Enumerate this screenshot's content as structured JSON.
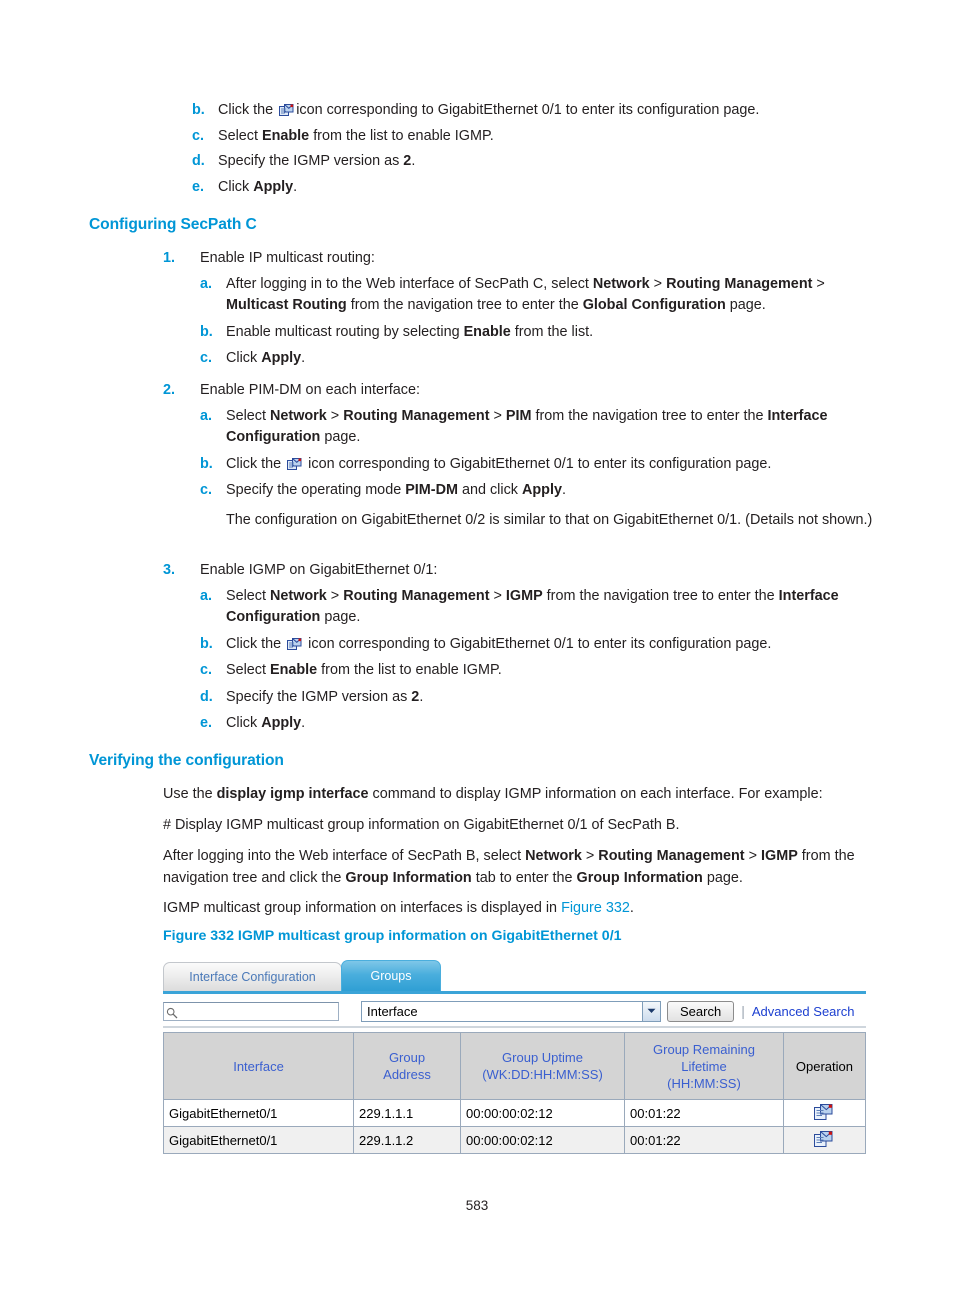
{
  "colors": {
    "heading_blue": "#0096d6",
    "marker_blue": "#0096d6",
    "link_blue": "#1c3fd0",
    "table_header_link": "#3a5fd0",
    "tab_active": "#2f9fd4"
  },
  "top_list": {
    "items": [
      {
        "marker": "b.",
        "pre": "Click the",
        "icon": "edit-document-icon",
        "post": "icon corresponding to GigabitEthernet 0/1 to enter its configuration page."
      },
      {
        "marker": "c.",
        "pre": "Select",
        "bold": "Enable",
        "post": "from the list to enable IGMP."
      },
      {
        "marker": "d.",
        "pre": "Specify the IGMP version as",
        "bold": "2",
        "post": "."
      },
      {
        "marker": "e.",
        "pre": "Click",
        "bold": "Apply",
        "post": "."
      }
    ]
  },
  "section_secpath_c": {
    "heading": "Configuring SecPath C",
    "step1": {
      "marker": "1.",
      "text": "Enable IP multicast routing:",
      "subs": [
        {
          "marker": "a.",
          "seg1": "After logging in to the Web interface of SecPath C, select ",
          "b1": "Network",
          "sep1": " > ",
          "b2": "Routing Management",
          "sep2": " > ",
          "b3": "Multicast Routing",
          "seg2": " from the navigation tree to enter the ",
          "b4": "Global Configuration",
          "seg3": " page."
        },
        {
          "marker": "b.",
          "seg1": "Enable multicast routing by selecting ",
          "b1": "Enable",
          "seg2": " from the list."
        },
        {
          "marker": "c.",
          "seg1": "Click ",
          "b1": "Apply",
          "seg2": "."
        }
      ]
    },
    "step2": {
      "marker": "2.",
      "text": "Enable PIM-DM on each interface:",
      "subs": [
        {
          "marker": "a.",
          "seg1": "Select ",
          "b1": "Network",
          "sep1": " > ",
          "b2": "Routing Management",
          "sep2": " > ",
          "b3": "PIM",
          "seg2": " from the navigation tree to enter the ",
          "b4": "Interface Configuration",
          "seg3": " page."
        },
        {
          "marker": "b.",
          "seg1": "Click the ",
          "icon": "edit-document-icon",
          "seg2": " icon corresponding to GigabitEthernet 0/1 to enter its configuration page."
        },
        {
          "marker": "c.",
          "seg1": "Specify the operating mode ",
          "b1": "PIM-DM",
          "seg2": " and click ",
          "b2": "Apply",
          "seg3": "."
        }
      ],
      "note": "The configuration on GigabitEthernet 0/2 is similar to that on GigabitEthernet 0/1. (Details not shown.)"
    },
    "step3": {
      "marker": "3.",
      "text": "Enable IGMP on GigabitEthernet 0/1:",
      "subs": [
        {
          "marker": "a.",
          "seg1": "Select ",
          "b1": "Network",
          "sep1": " > ",
          "b2": "Routing Management",
          "sep2": " > ",
          "b3": "IGMP",
          "seg2": " from the navigation tree to enter the ",
          "b4": "Interface Configuration",
          "seg3": " page."
        },
        {
          "marker": "b.",
          "seg1": "Click the ",
          "icon": "edit-document-icon",
          "seg2": " icon corresponding to GigabitEthernet 0/1 to enter its configuration page."
        },
        {
          "marker": "c.",
          "seg1": "Select ",
          "b1": "Enable",
          "seg2": " from the list to enable IGMP."
        },
        {
          "marker": "d.",
          "seg1": "Specify the IGMP version as ",
          "b1": "2",
          "seg2": "."
        },
        {
          "marker": "e.",
          "seg1": "Click ",
          "b1": "Apply",
          "seg2": "."
        }
      ]
    }
  },
  "section_verify": {
    "heading": "Verifying the configuration",
    "p1_a": "Use the ",
    "p1_b": "display igmp interface",
    "p1_c": " command to display IGMP information on each interface. For example:",
    "p2": "# Display IGMP multicast group information on GigabitEthernet 0/1 of SecPath B.",
    "p3_a": "After logging into the Web interface of SecPath B, select ",
    "p3_b1": "Network",
    "p3_sep1": " > ",
    "p3_b2": "Routing Management",
    "p3_sep2": " > ",
    "p3_b3": "IGMP",
    "p3_c": " from the navigation tree and click the ",
    "p3_b4": "Group Information",
    "p3_d": " tab to enter the ",
    "p3_b5": "Group Information",
    "p3_e": " page.",
    "p4_a": "IGMP multicast group information on interfaces is displayed in ",
    "p4_link": "Figure 332",
    "p4_b": ".",
    "figure_caption": "Figure 332 IGMP multicast group information on GigabitEthernet 0/1"
  },
  "ui": {
    "tabs": [
      {
        "label": "Interface Configuration",
        "active": false
      },
      {
        "label": "Groups",
        "active": true
      }
    ],
    "search": {
      "input_value": "",
      "input_placeholder": "",
      "select_value": "Interface",
      "search_button": "Search",
      "advanced_link": "Advanced Search",
      "divider": "|"
    },
    "table": {
      "headers": [
        {
          "lines": [
            "Interface"
          ],
          "link": true
        },
        {
          "lines": [
            "Group",
            "Address"
          ],
          "link": true
        },
        {
          "lines": [
            "Group Uptime",
            "(WK:DD:HH:MM:SS)"
          ],
          "link": true
        },
        {
          "lines": [
            "Group Remaining",
            "Lifetime",
            "(HH:MM:SS)"
          ],
          "link": true
        },
        {
          "lines": [
            "Operation"
          ],
          "link": false
        }
      ],
      "rows": [
        {
          "interface": "GigabitEthernet0/1",
          "group_address": "229.1.1.1",
          "group_uptime": "00:00:00:02:12",
          "group_remaining_lifetime": "00:01:22",
          "operation_icon": "edit-document-icon"
        },
        {
          "interface": "GigabitEthernet0/1",
          "group_address": "229.1.1.2",
          "group_uptime": "00:00:00:02:12",
          "group_remaining_lifetime": "00:01:22",
          "operation_icon": "edit-document-icon"
        }
      ]
    }
  },
  "footer": {
    "page_number": "583"
  }
}
